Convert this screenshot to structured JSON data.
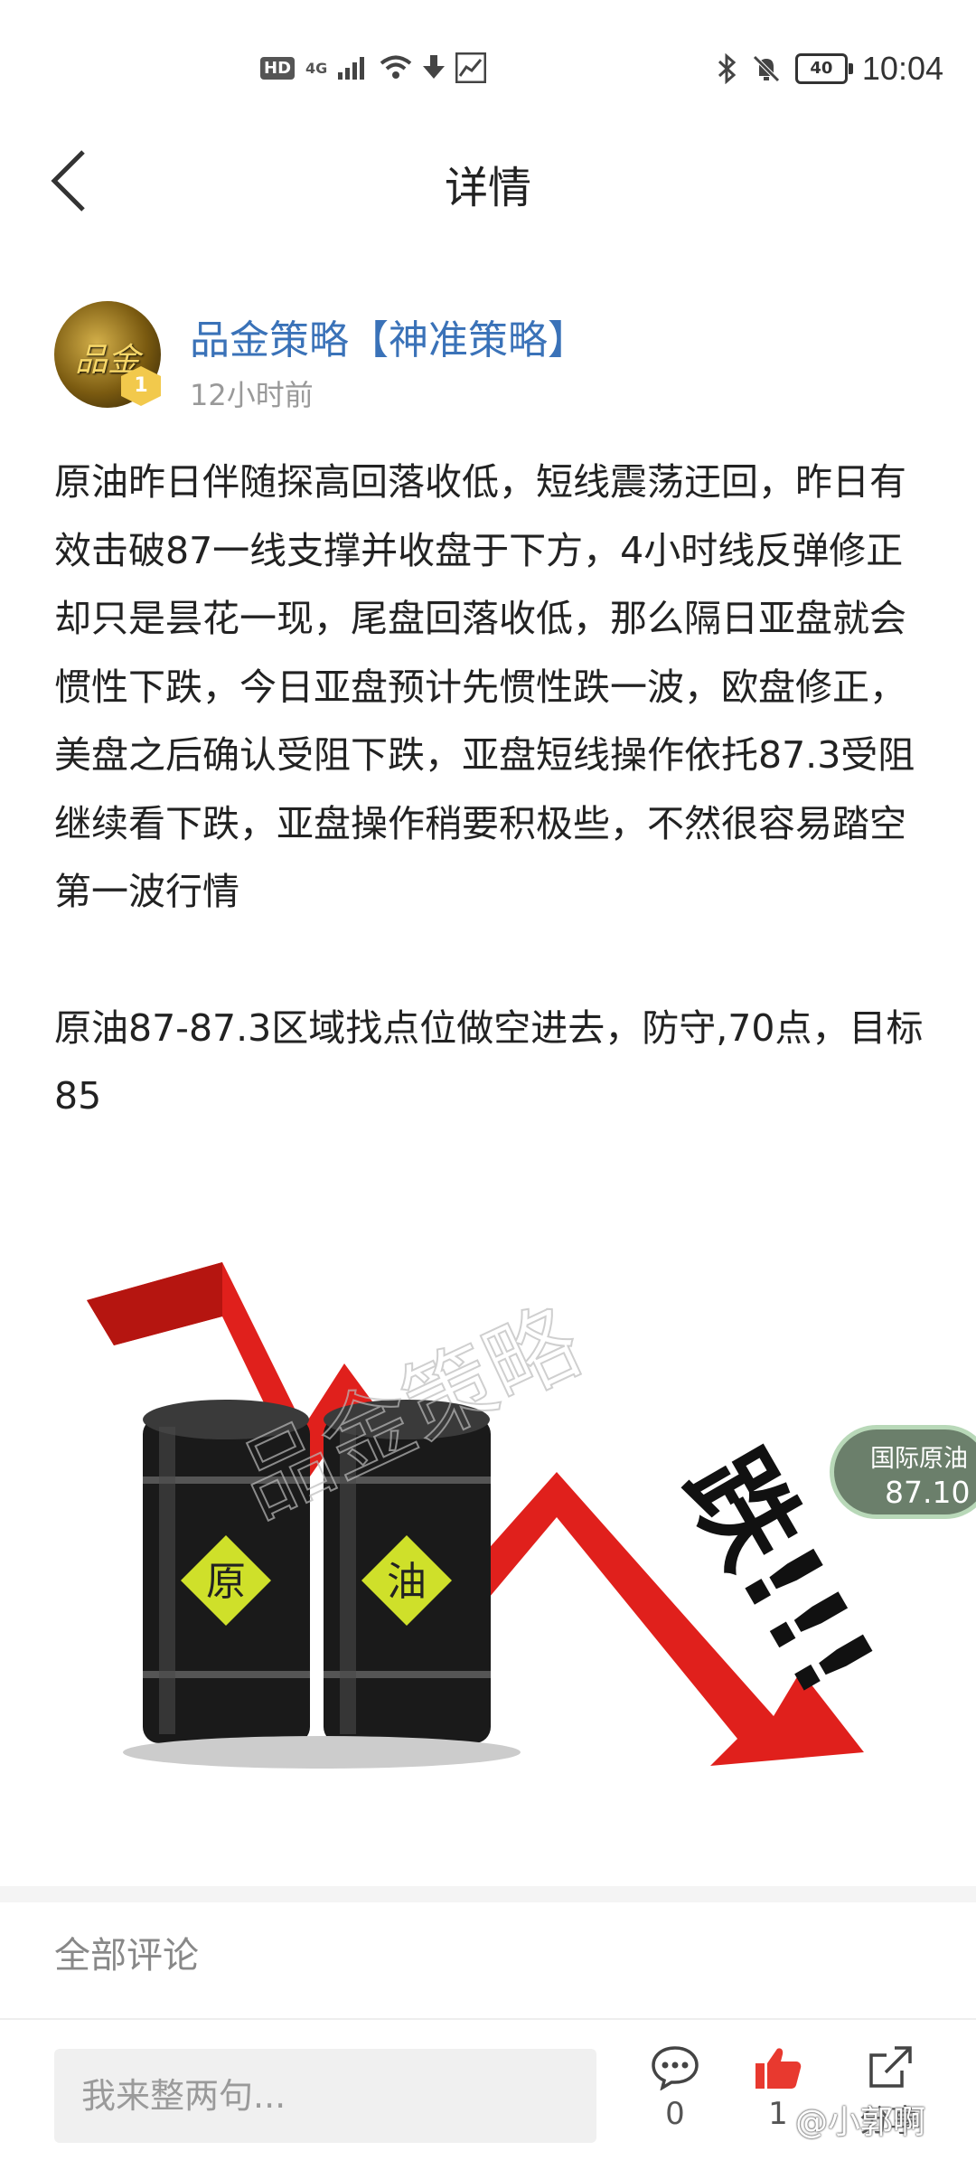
{
  "status_bar": {
    "hd": "HD",
    "network": "4G",
    "battery": "40",
    "time": "10:04"
  },
  "header": {
    "title": "详情"
  },
  "author": {
    "name": "品金策略【神准策略】",
    "time": "12小时前",
    "level": "1",
    "avatar_text": "品金"
  },
  "post": {
    "paragraph1": "原油昨日伴随探高回落收低，短线震荡迂回，昨日有效击破87一线支撑并收盘于下方，4小时线反弹修正却只是昙花一现，尾盘回落收低，那么隔日亚盘就会惯性下跌，今日亚盘预计先惯性跌一波，欧盘修正，美盘之后确认受阻下跌，亚盘短线操作依托87.3受阻继续看下跌，亚盘操作稍要积极些，不然很容易踏空第一波行情",
    "paragraph2": "原油87-87.3区域找点位做空进去，防守,70点，目标85"
  },
  "image": {
    "headline": "跌!!!",
    "barrel1": "原",
    "barrel2": "油",
    "watermark": "品金策略"
  },
  "quote": {
    "name": "国际原油",
    "value": "87.10"
  },
  "comments": {
    "title": "全部评论",
    "input_placeholder": "我来整两句...",
    "comment_count": "0",
    "like_count": "1",
    "share_label": "分享"
  },
  "footer_watermark": "@小郭啊",
  "colors": {
    "accent": "#3a72b8",
    "arrow_red": "#e0201c",
    "like_red": "#e8392f"
  }
}
